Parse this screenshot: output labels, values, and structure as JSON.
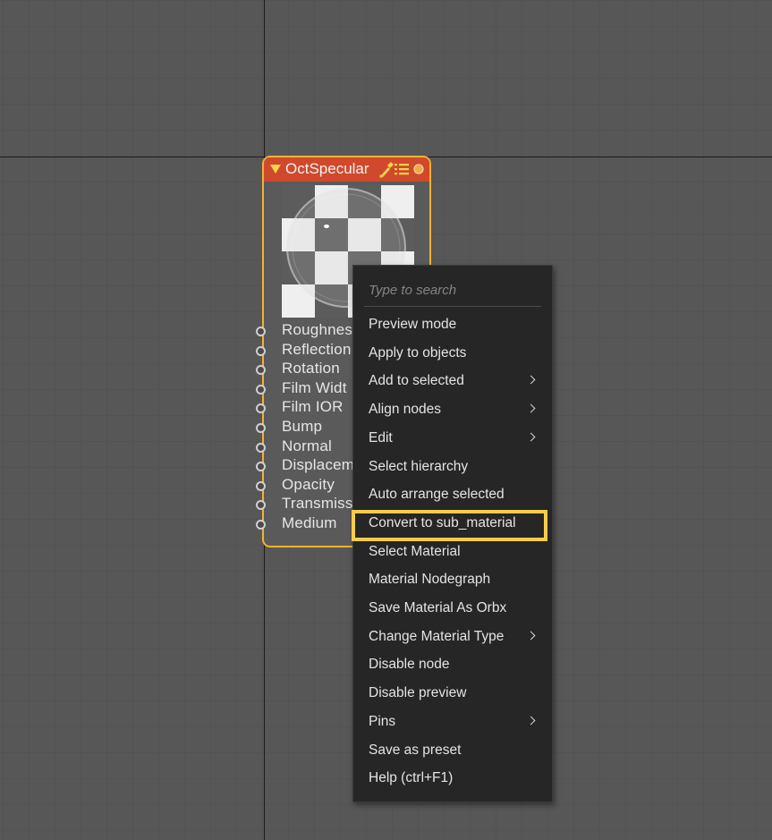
{
  "node": {
    "title": "OctSpecular",
    "header_color": "#d0492c",
    "border_color": "#f0b232",
    "header_icons": [
      "pipette-icon",
      "list-icon",
      "status-dot-icon"
    ],
    "pins": [
      "Roughnes",
      "Reflection",
      "Rotation",
      "Film Widt",
      "Film IOR",
      "Bump",
      "Normal",
      "Displacem",
      "Opacity",
      "Transmiss",
      "Medium"
    ]
  },
  "context_menu": {
    "search_placeholder": "Type to search",
    "items": [
      {
        "label": "Preview mode",
        "submenu": false
      },
      {
        "label": "Apply to objects",
        "submenu": false
      },
      {
        "label": "Add to selected",
        "submenu": true
      },
      {
        "label": "Align nodes",
        "submenu": true
      },
      {
        "label": "Edit",
        "submenu": true
      },
      {
        "label": "Select hierarchy",
        "submenu": false
      },
      {
        "label": "Auto arrange selected",
        "submenu": false
      },
      {
        "label": "Convert to sub_material",
        "submenu": false,
        "highlighted": true
      },
      {
        "label": "Select Material",
        "submenu": false
      },
      {
        "label": "Material Nodegraph",
        "submenu": false
      },
      {
        "label": "Save Material As Orbx",
        "submenu": false
      },
      {
        "label": "Change Material Type",
        "submenu": true
      },
      {
        "label": "Disable node",
        "submenu": false
      },
      {
        "label": "Disable preview",
        "submenu": false
      },
      {
        "label": "Pins",
        "submenu": true
      },
      {
        "label": "Save as preset",
        "submenu": false
      },
      {
        "label": "Help (ctrl+F1)",
        "submenu": false
      }
    ],
    "highlight_color": "#f6cc4b"
  }
}
